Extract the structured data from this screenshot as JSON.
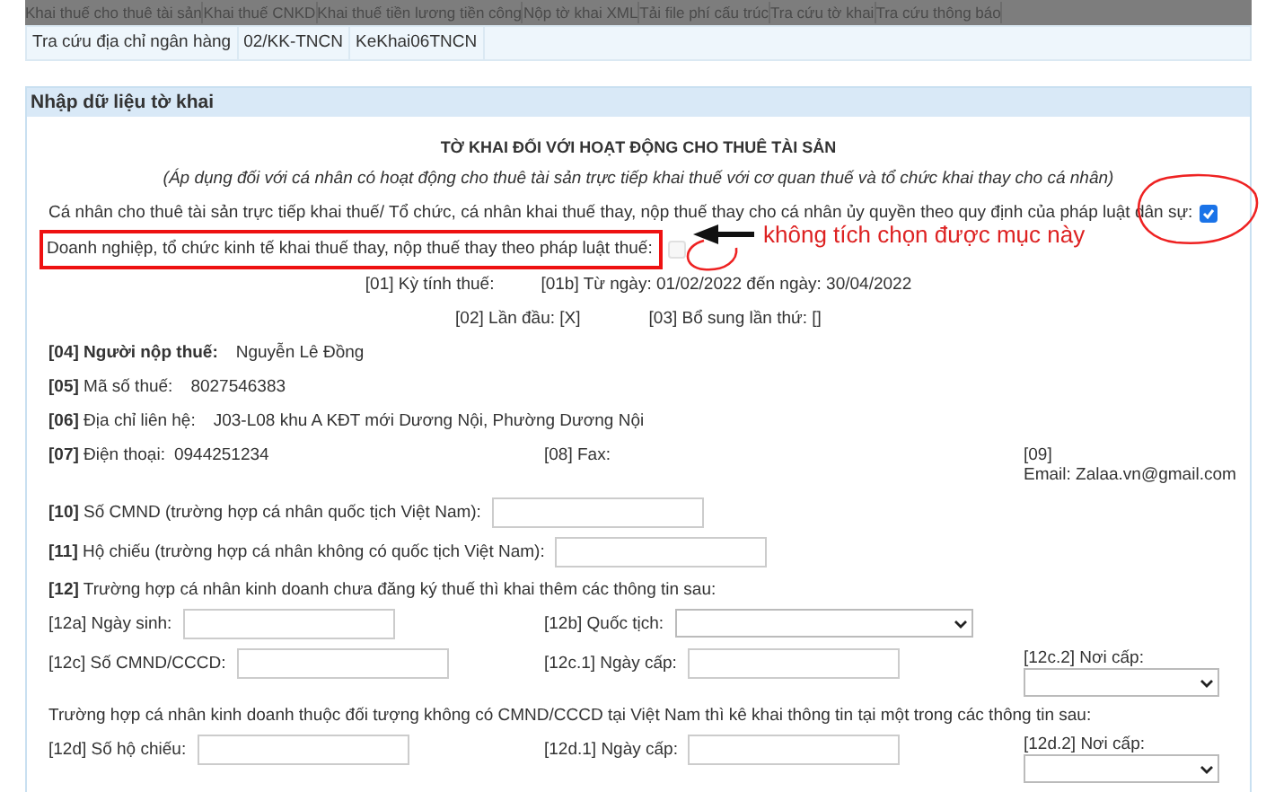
{
  "top_menu": [
    "Khai thuế cho thuê tài sản",
    "Khai thuế CNKD",
    "Khai thuế tiền lương tiền công",
    "Nộp tờ khai XML",
    "Tải file phí cấu trúc",
    "Tra cứu tờ khai",
    "Tra cứu thông báo"
  ],
  "lookup_row": [
    "Tra cứu địa chỉ ngân hàng",
    "02/KK-TNCN",
    "KeKhai06TNCN"
  ],
  "section": {
    "title": "Nhập dữ liệu tờ khai"
  },
  "form": {
    "title": "TỜ KHAI ĐỐI VỚI HOẠT ĐỘNG CHO THUÊ TÀI SẢN",
    "subtitle": "(Áp dụng đối với cá nhân có hoạt động cho thuê tài sản trực tiếp khai thuế với cơ quan thuế và tổ chức khai thay cho cá nhân)",
    "options": [
      {
        "label": "Cá nhân cho thuê tài sản trực tiếp khai thuế/ Tổ chức, cá nhân khai thuế thay, nộp thuế thay cho cá nhân ủy quyền theo quy định của pháp luật dân sự:",
        "checked": true,
        "disabled": false
      },
      {
        "label": "Doanh nghiệp, tổ chức kinh tế khai thuế thay, nộp thuế thay theo pháp luật thuế:",
        "checked": false,
        "disabled": true
      }
    ],
    "period": [
      "[01] Kỳ tính thuế:",
      "[01b] Từ ngày: 01/02/2022 đến ngày: 30/04/2022"
    ],
    "status": [
      "[02] Lần đầu: [X]",
      "[03] Bổ sung lần thứ: []"
    ],
    "info": [
      {
        "label": "**[04] Người nộp thuế:**",
        "value": "Nguyễn Lê Đồng"
      },
      {
        "label": "**[05]** Mã số thuế:",
        "value": "8027546383"
      },
      {
        "label": "**[06]** Địa chỉ liên hệ:",
        "value": "J03-L08 khu A KĐT mới Dương Nội, Phường Dương Nội"
      }
    ],
    "contact": {
      "phone_label": "**[07]** Điện thoại:",
      "phone": "0944251234",
      "fax_label": "[08] Fax:",
      "email_code": "[09]",
      "email": "Email: Zalaa.vn@gmail.com"
    },
    "rows": [
      {
        "kind": "field",
        "label": "**[10]** Số CMND (trường hợp cá nhân quốc tịch Việt Nam):"
      },
      {
        "kind": "field",
        "label": "**[11]** Hộ chiếu (trường hợp cá nhân không có quốc tịch Việt Nam):"
      },
      {
        "kind": "note",
        "label": "**[12]** Trường hợp cá nhân kinh doanh chưa đăng ký thuế thì khai thêm các thông tin sau:"
      },
      {
        "kind": "grid",
        "cells": [
          {
            "label": "[12a] Ngày sinh:",
            "kind": "text"
          },
          {
            "label": "[12b] Quốc tịch:",
            "kind": "select"
          }
        ]
      },
      {
        "kind": "grid",
        "cells": [
          {
            "label": "[12c] Số CMND/CCCD:",
            "kind": "text"
          },
          {
            "label": "[12c.1] Ngày cấp:",
            "kind": "text"
          },
          {
            "label": "[12c.2] Nơi cấp:",
            "kind": "select"
          }
        ]
      },
      {
        "kind": "note",
        "label": "Trường hợp cá nhân kinh doanh thuộc đối tượng không có CMND/CCCD tại Việt Nam thì kê khai thông tin tại một trong các thông tin sau:"
      },
      {
        "kind": "grid",
        "cells": [
          {
            "label": "[12d] Số hộ chiếu:",
            "kind": "text"
          },
          {
            "label": "[12d.1] Ngày cấp:",
            "kind": "text"
          },
          {
            "label": "[12d.2] Nơi cấp:",
            "kind": "select"
          }
        ]
      }
    ]
  },
  "annotation": {
    "note": "không tích chọn được mục này"
  }
}
